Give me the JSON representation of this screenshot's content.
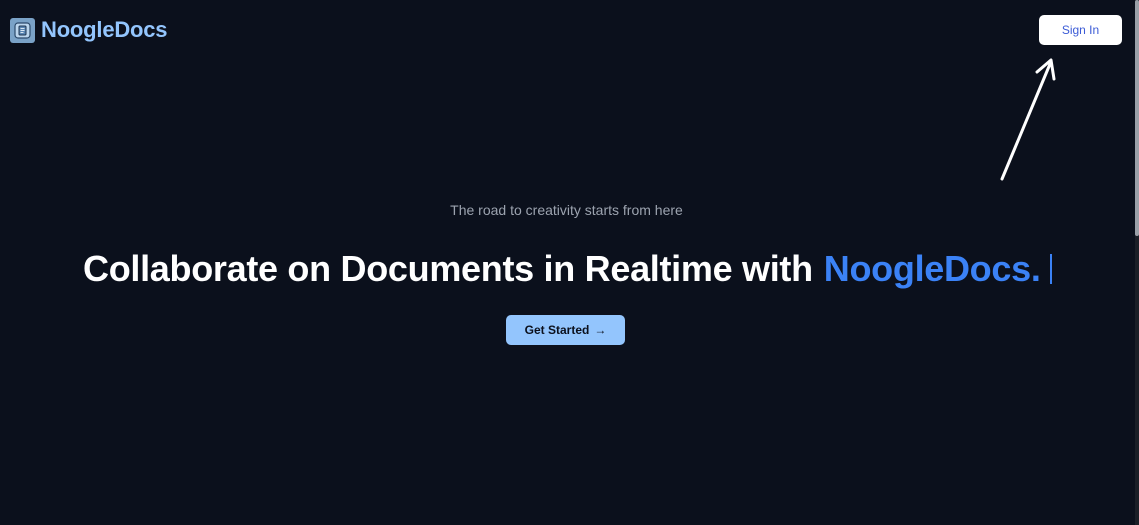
{
  "header": {
    "brand_name": "NoogleDocs",
    "logo_icon": "document-icon",
    "signin_label": "Sign In"
  },
  "hero": {
    "tagline": "The road to creativity starts from here",
    "headline": "Collaborate on Documents in Realtime with",
    "headline_brand": "NoogleDocs.",
    "cta_label": "Get Started",
    "cta_icon": "arrow-right-icon"
  },
  "colors": {
    "background": "#0b101c",
    "brand_accent": "#93c5fd",
    "headline_accent": "#3b82f6",
    "signin_text": "#3b5bd6"
  }
}
